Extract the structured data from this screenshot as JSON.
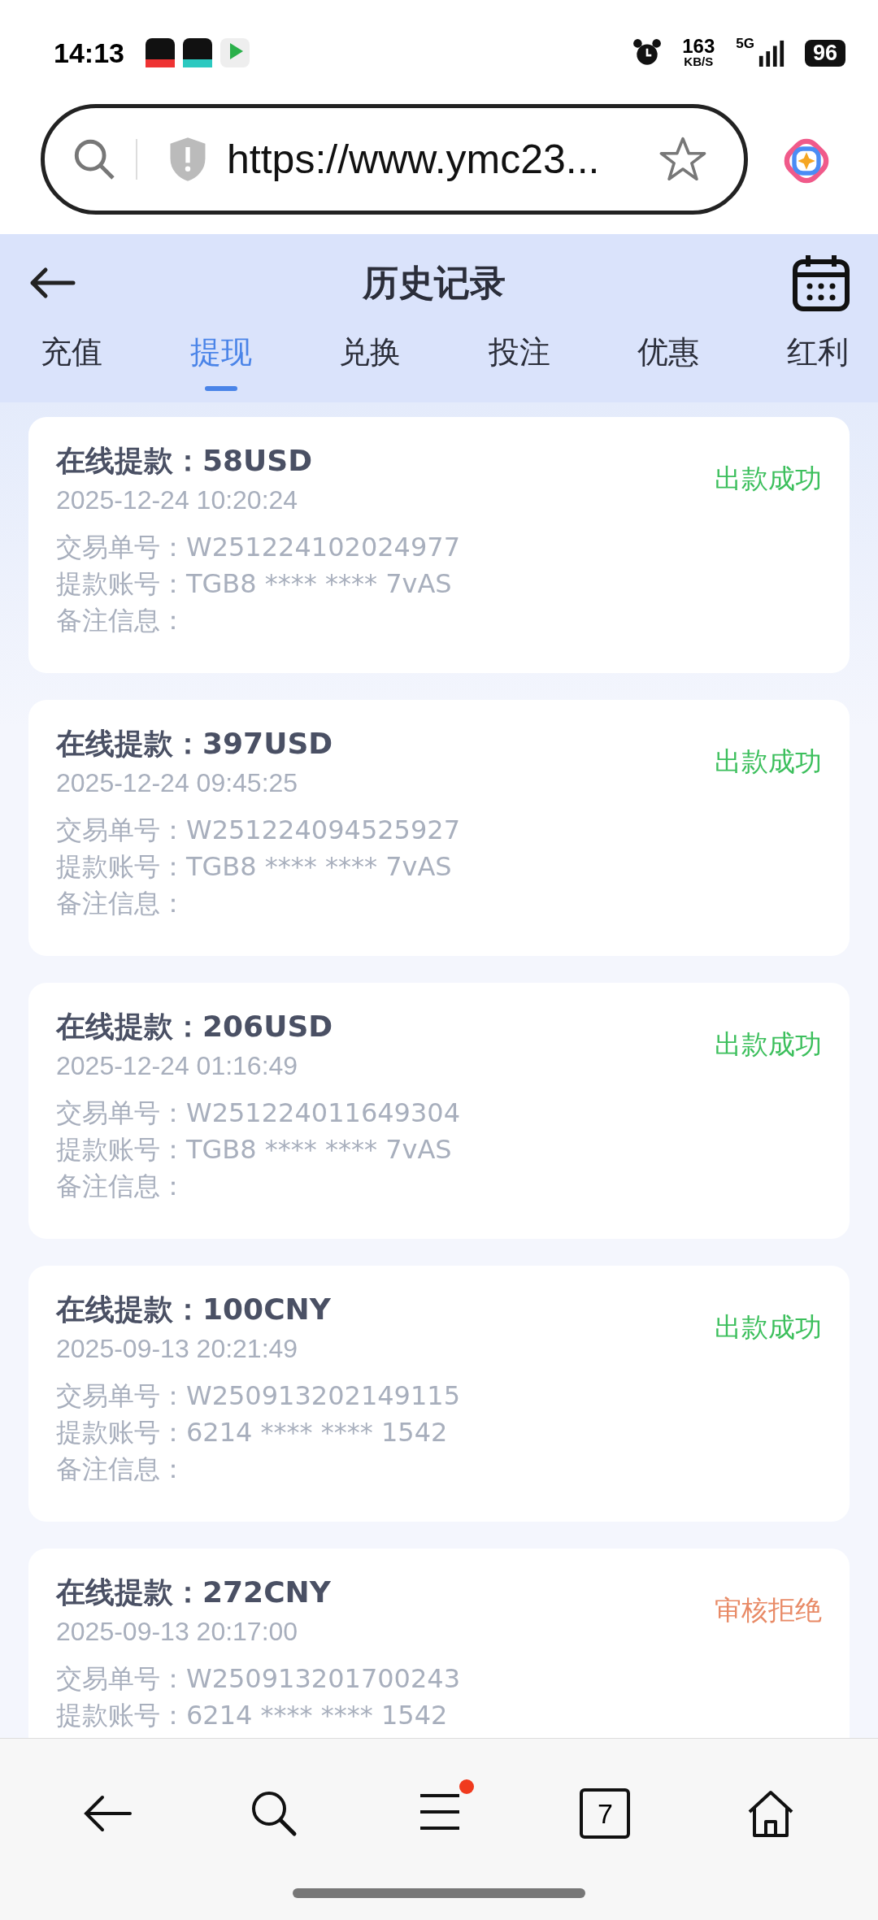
{
  "status_bar": {
    "time": "14:13",
    "speed": "163",
    "speed_unit": "KB/S",
    "network": "5G",
    "battery": "96"
  },
  "browser": {
    "url": "https://www.ymc23..."
  },
  "header": {
    "title": "历史记录"
  },
  "tabs": [
    {
      "label": "充值",
      "selected": false
    },
    {
      "label": "提现",
      "selected": true
    },
    {
      "label": "兑换",
      "selected": false
    },
    {
      "label": "投注",
      "selected": false
    },
    {
      "label": "优惠",
      "selected": false
    },
    {
      "label": "红利",
      "selected": false
    }
  ],
  "records": [
    {
      "title": "在线提款：58USD",
      "time": "2025-12-24 10:20:24",
      "status": "出款成功",
      "kind": "success",
      "lines": [
        "交易单号：W251224102024977",
        "提款账号：TGB8 **** **** 7vAS",
        "备注信息："
      ]
    },
    {
      "title": "在线提款：397USD",
      "time": "2025-12-24 09:45:25",
      "status": "出款成功",
      "kind": "success",
      "lines": [
        "交易单号：W251224094525927",
        "提款账号：TGB8 **** **** 7vAS",
        "备注信息："
      ]
    },
    {
      "title": "在线提款：206USD",
      "time": "2025-12-24 01:16:49",
      "status": "出款成功",
      "kind": "success",
      "lines": [
        "交易单号：W251224011649304",
        "提款账号：TGB8 **** **** 7vAS",
        "备注信息："
      ]
    },
    {
      "title": "在线提款：100CNY",
      "time": "2025-09-13 20:21:49",
      "status": "出款成功",
      "kind": "success",
      "lines": [
        "交易单号：W250913202149115",
        "提款账号：6214 **** **** 1542",
        "备注信息："
      ]
    },
    {
      "title": "在线提款：272CNY",
      "time": "2025-09-13 20:17:00",
      "status": "审核拒绝",
      "kind": "rejected",
      "lines": [
        "交易单号：W250913201700243",
        "提款账号：6214 **** **** 1542"
      ]
    }
  ],
  "bottom_bar": {
    "tab_count": "7",
    "menu_badge": true
  }
}
